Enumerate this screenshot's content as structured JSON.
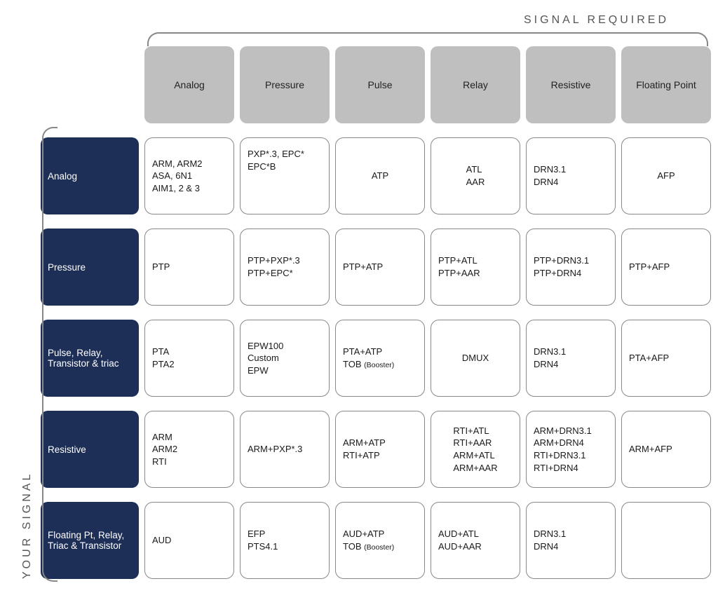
{
  "labels": {
    "top": "SIGNAL REQUIRED",
    "left": "YOUR SIGNAL"
  },
  "columns": [
    "Analog",
    "Pressure",
    "Pulse",
    "Relay",
    "Resistive",
    "Floating Point"
  ],
  "rows": [
    "Analog",
    "Pressure",
    "Pulse, Relay, Transistor & triac",
    "Resistive",
    "Floating Pt, Relay, Triac & Transistor"
  ],
  "cells": {
    "r0": {
      "c0": "ARM, ARM2\nASA, 6N1\nAIM1, 2 & 3",
      "c1": "PXP*.3, EPC*\nEPC*B",
      "c2": "ATP",
      "c3": "ATL\nAAR",
      "c4": "DRN3.1\nDRN4",
      "c5": "AFP"
    },
    "r1": {
      "c0": "PTP",
      "c1": "PTP+PXP*.3\nPTP+EPC*",
      "c2": "PTP+ATP",
      "c3": "PTP+ATL\nPTP+AAR",
      "c4": "PTP+DRN3.1\nPTP+DRN4",
      "c5": "PTP+AFP"
    },
    "r2": {
      "c0": "PTA\nPTA2",
      "c1": "EPW100\nCustom\nEPW",
      "c2_a": "PTA+ATP",
      "c2_b": "TOB ",
      "c2_s": "(Booster)",
      "c3": "DMUX",
      "c4": "DRN3.1\nDRN4",
      "c5": "PTA+AFP"
    },
    "r3": {
      "c0": "ARM\nARM2\nRTI",
      "c1": "ARM+PXP*.3",
      "c2": "ARM+ATP\nRTI+ATP",
      "c3": "RTI+ATL\nRTI+AAR\nARM+ATL\nARM+AAR",
      "c4": "ARM+DRN3.1\nARM+DRN4\nRTI+DRN3.1\nRTI+DRN4",
      "c5": "ARM+AFP"
    },
    "r4": {
      "c0": "AUD",
      "c1": "EFP\nPTS4.1",
      "c2_a": "AUD+ATP",
      "c2_b": "TOB ",
      "c2_s": "(Booster)",
      "c3": "AUD+ATL\nAUD+AAR",
      "c4": "DRN3.1\nDRN4",
      "c5": ""
    }
  }
}
